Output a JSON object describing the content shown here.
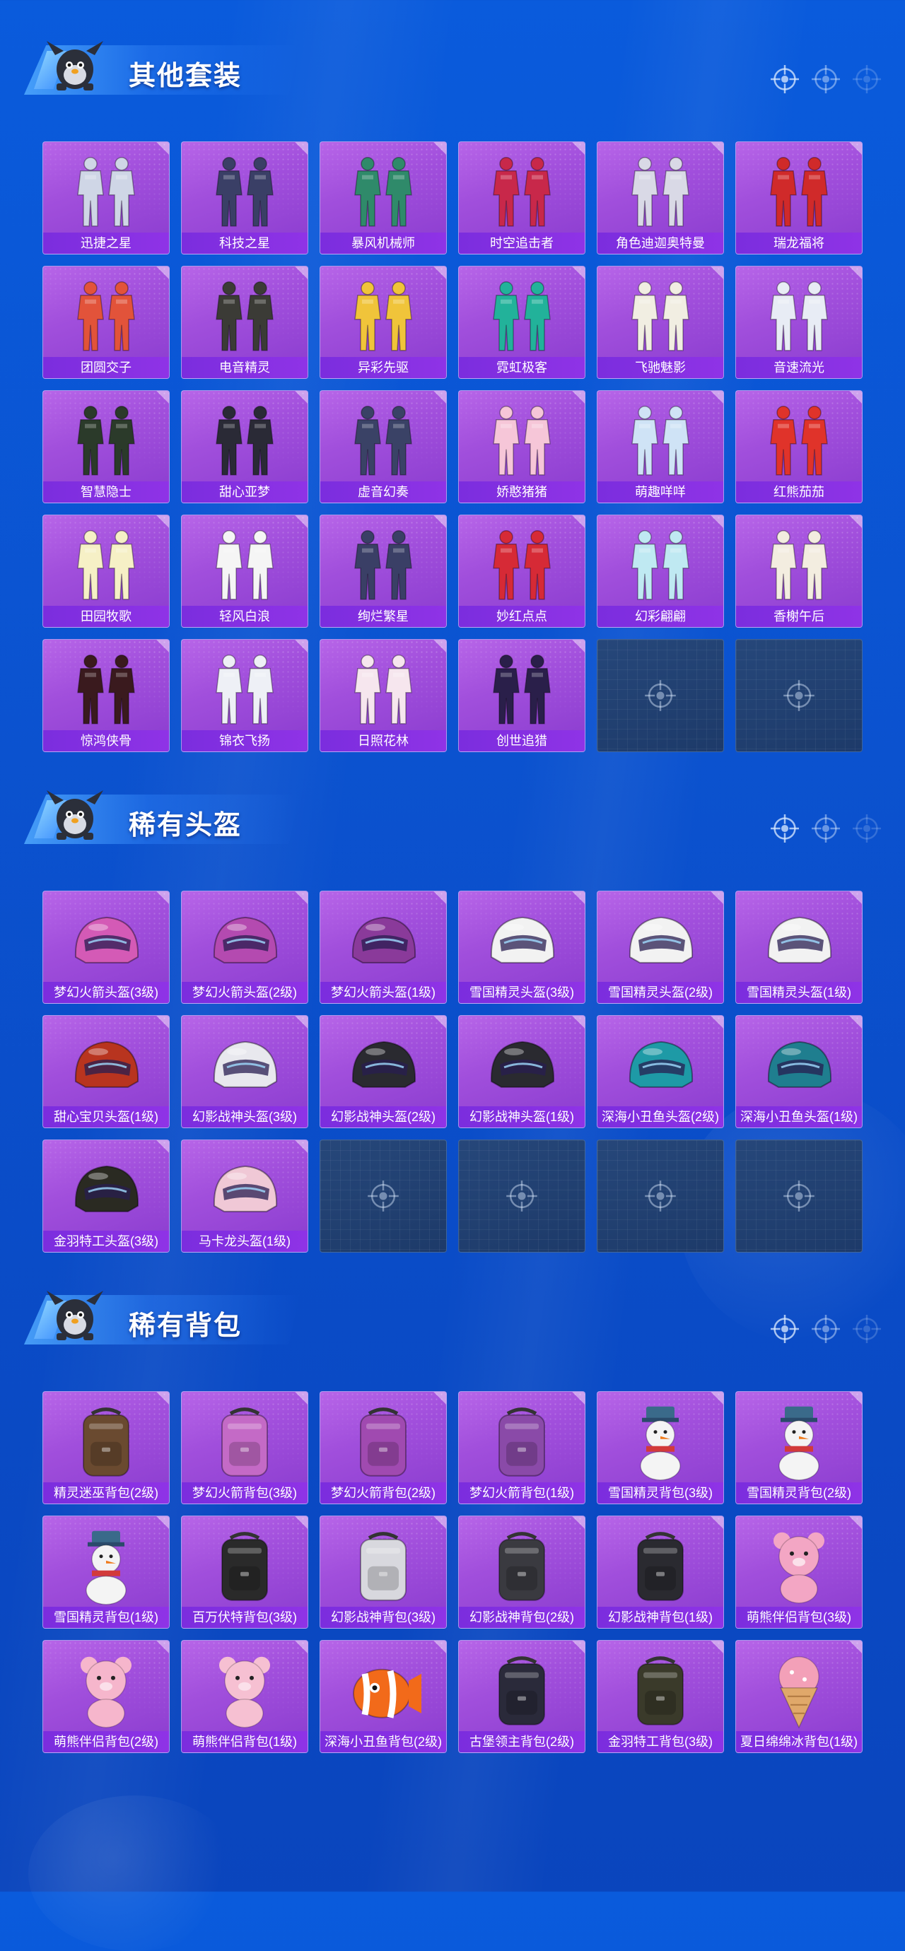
{
  "sections": [
    {
      "title": "其他套装",
      "items": [
        {
          "label": "迅捷之星",
          "kind": "suit",
          "color": "#cfd6e6"
        },
        {
          "label": "科技之星",
          "kind": "suit",
          "color": "#3a3f66"
        },
        {
          "label": "暴风机械师",
          "kind": "suit",
          "color": "#2f8a6a"
        },
        {
          "label": "时空追击者",
          "kind": "suit",
          "color": "#c8284a"
        },
        {
          "label": "角色迪迦奥特曼",
          "kind": "suit",
          "color": "#d9d9e6"
        },
        {
          "label": "瑞龙福将",
          "kind": "suit",
          "color": "#d02a2a"
        },
        {
          "label": "团圆交子",
          "kind": "suit",
          "color": "#e2533a"
        },
        {
          "label": "电音精灵",
          "kind": "suit",
          "color": "#3b3b36"
        },
        {
          "label": "异彩先驱",
          "kind": "suit",
          "color": "#f0c43a"
        },
        {
          "label": "霓虹极客",
          "kind": "suit",
          "color": "#22b29a"
        },
        {
          "label": "飞驰魅影",
          "kind": "suit",
          "color": "#f1eee2"
        },
        {
          "label": "音速流光",
          "kind": "suit",
          "color": "#e8ecf5"
        },
        {
          "label": "智慧隐士",
          "kind": "suit",
          "color": "#2b3a2a"
        },
        {
          "label": "甜心亚梦",
          "kind": "suit",
          "color": "#2a2a36"
        },
        {
          "label": "虚音幻奏",
          "kind": "suit",
          "color": "#3a4266"
        },
        {
          "label": "娇憨猪猪",
          "kind": "suit",
          "color": "#f6c6d8"
        },
        {
          "label": "萌趣咩咩",
          "kind": "suit",
          "color": "#cfe3f6"
        },
        {
          "label": "红熊茄茄",
          "kind": "suit",
          "color": "#e0332a"
        },
        {
          "label": "田园牧歌",
          "kind": "suit",
          "color": "#f6f0c6"
        },
        {
          "label": "轻风白浪",
          "kind": "suit",
          "color": "#f5f5f5"
        },
        {
          "label": "绚烂繁星",
          "kind": "suit",
          "color": "#3a3f66"
        },
        {
          "label": "妙红点点",
          "kind": "suit",
          "color": "#d62a36"
        },
        {
          "label": "幻彩翩翩",
          "kind": "suit",
          "color": "#bfe9f2"
        },
        {
          "label": "香榭午后",
          "kind": "suit",
          "color": "#f3ede0"
        },
        {
          "label": "惊鸿侠骨",
          "kind": "suit",
          "color": "#3a1a1e"
        },
        {
          "label": "锦衣飞扬",
          "kind": "suit",
          "color": "#eef0f6"
        },
        {
          "label": "日照花林",
          "kind": "suit",
          "color": "#f6e6ee"
        },
        {
          "label": "创世追猎",
          "kind": "suit",
          "color": "#2a1f4a"
        },
        {
          "label": "",
          "kind": "empty"
        },
        {
          "label": "",
          "kind": "empty"
        }
      ]
    },
    {
      "title": "稀有头盔",
      "items": [
        {
          "label": "梦幻火箭头盔(3级)",
          "kind": "helmet",
          "color": "#d45ab6"
        },
        {
          "label": "梦幻火箭头盔(2级)",
          "kind": "helmet",
          "color": "#b44ab0"
        },
        {
          "label": "梦幻火箭头盔(1级)",
          "kind": "helmet",
          "color": "#8a3a9a"
        },
        {
          "label": "雪国精灵头盔(3级)",
          "kind": "helmet",
          "color": "#f2f2f2"
        },
        {
          "label": "雪国精灵头盔(2级)",
          "kind": "helmet",
          "color": "#f2f2f2"
        },
        {
          "label": "雪国精灵头盔(1级)",
          "kind": "helmet",
          "color": "#f2f2f2"
        },
        {
          "label": "甜心宝贝头盔(1级)",
          "kind": "helmet",
          "color": "#b8341f"
        },
        {
          "label": "幻影战神头盔(3级)",
          "kind": "helmet",
          "color": "#e8e8ee"
        },
        {
          "label": "幻影战神头盔(2级)",
          "kind": "helmet",
          "color": "#2a2a30"
        },
        {
          "label": "幻影战神头盔(1级)",
          "kind": "helmet",
          "color": "#2a2a30"
        },
        {
          "label": "深海小丑鱼头盔(2级)",
          "kind": "helmet",
          "color": "#1e9aa6"
        },
        {
          "label": "深海小丑鱼头盔(1级)",
          "kind": "helmet",
          "color": "#1f7e8f"
        },
        {
          "label": "金羽特工头盔(3级)",
          "kind": "helmet",
          "color": "#2a2a22"
        },
        {
          "label": "马卡龙头盔(1级)",
          "kind": "helmet",
          "color": "#f0c8d6"
        },
        {
          "label": "",
          "kind": "empty"
        },
        {
          "label": "",
          "kind": "empty"
        },
        {
          "label": "",
          "kind": "empty"
        },
        {
          "label": "",
          "kind": "empty"
        }
      ]
    },
    {
      "title": "稀有背包",
      "items": [
        {
          "label": "精灵迷巫背包(2级)",
          "kind": "backpack",
          "color": "#6a4a30"
        },
        {
          "label": "梦幻火箭背包(3级)",
          "kind": "backpack",
          "color": "#c46ac6"
        },
        {
          "label": "梦幻火箭背包(2级)",
          "kind": "backpack",
          "color": "#a04ab0"
        },
        {
          "label": "梦幻火箭背包(1级)",
          "kind": "backpack",
          "color": "#8a4aa8"
        },
        {
          "label": "雪国精灵背包(3级)",
          "kind": "snowman",
          "color": "#f4f4f4"
        },
        {
          "label": "雪国精灵背包(2级)",
          "kind": "snowman",
          "color": "#f4f4f4"
        },
        {
          "label": "雪国精灵背包(1级)",
          "kind": "snowman",
          "color": "#f4f4f4"
        },
        {
          "label": "百万伏特背包(3级)",
          "kind": "backpack",
          "color": "#2a2a2a"
        },
        {
          "label": "幻影战神背包(3级)",
          "kind": "backpack",
          "color": "#d8d8de"
        },
        {
          "label": "幻影战神背包(2级)",
          "kind": "backpack",
          "color": "#3a3a40"
        },
        {
          "label": "幻影战神背包(1级)",
          "kind": "backpack",
          "color": "#2a2a30"
        },
        {
          "label": "萌熊伴侣背包(3级)",
          "kind": "bear",
          "color": "#f3a6c4"
        },
        {
          "label": "萌熊伴侣背包(2级)",
          "kind": "bear",
          "color": "#f6b6cc"
        },
        {
          "label": "萌熊伴侣背包(1级)",
          "kind": "bear",
          "color": "#f6c0d2"
        },
        {
          "label": "深海小丑鱼背包(2级)",
          "kind": "fish",
          "color": "#f26a1a"
        },
        {
          "label": "古堡领主背包(2级)",
          "kind": "backpack",
          "color": "#2a2a3a"
        },
        {
          "label": "金羽特工背包(3级)",
          "kind": "backpack",
          "color": "#3a3a2a"
        },
        {
          "label": "夏日绵绵冰背包(1级)",
          "kind": "icecream",
          "color": "#f3a0b8"
        }
      ]
    }
  ]
}
